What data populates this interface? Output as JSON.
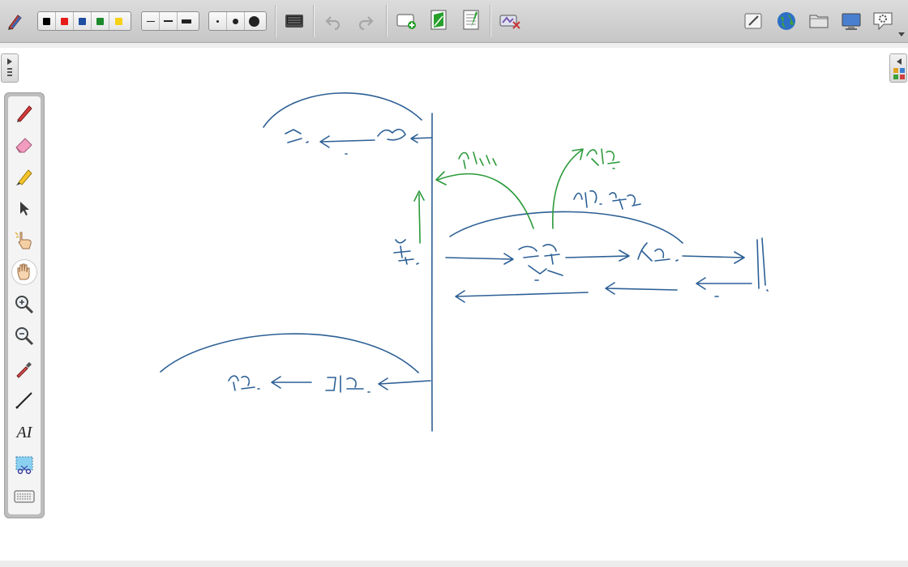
{
  "colors": {
    "toolbar_bg": "#cfcfcf",
    "ink_blue": "#2c5f95",
    "ink_green": "#2b9a3a"
  },
  "toolbar": {
    "color_swatches": [
      {
        "name": "black",
        "hex": "#000000"
      },
      {
        "name": "red",
        "hex": "#e81b1b"
      },
      {
        "name": "blue",
        "hex": "#1f4fa0"
      },
      {
        "name": "green",
        "hex": "#1c8a2c"
      },
      {
        "name": "yellow",
        "hex": "#f5d218"
      }
    ],
    "line_widths": [
      "thin",
      "medium",
      "thick"
    ],
    "dot_sizes": [
      "small",
      "medium",
      "large"
    ],
    "icons": [
      "pen-settings-icon",
      "keyboard-icon",
      "undo-icon",
      "redo-icon",
      "new-page-icon",
      "page-green-icon",
      "page-list-icon",
      "clear-icon",
      "edit-icon",
      "globe-icon",
      "folder-icon",
      "screen-icon",
      "settings-icon"
    ]
  },
  "palette": {
    "tools": [
      "pen-icon",
      "eraser-icon",
      "highlighter-icon",
      "pointer-icon",
      "hand-pointer-icon",
      "hand-icon",
      "zoom-in-icon",
      "zoom-out-icon",
      "eyedropper-icon",
      "line-icon",
      "text-icon",
      "screen-capture-icon",
      "keyboard-icon"
    ],
    "text_tool_label": "AI"
  }
}
